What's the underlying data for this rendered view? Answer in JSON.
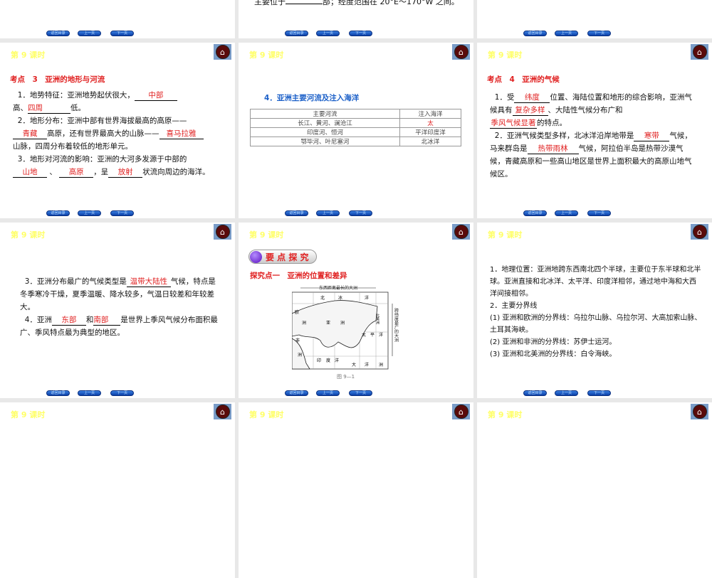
{
  "common": {
    "lesson": "第 9 课时",
    "nav": [
      "返回目录",
      "上一页",
      "下一页"
    ]
  },
  "s_top2": {
    "text": "主要位于",
    "blank": "",
    "rest": "部；经度范围在 20°E～170°W 之间。"
  },
  "s3": {
    "heading": "考点　3　亚洲的地形与河流",
    "p1a": "1．地势特征：亚洲地势起伏很大，",
    "b1": "中部",
    "p1b": "高、",
    "b2": "四周",
    "p1c": "低。",
    "p2a": "2．地形分布：亚洲中部有世界海拔最高的高原——",
    "b3": "青藏",
    "p2b": "高原，还有世界最高大的山脉——",
    "b4": "喜马拉雅",
    "p2c": "山脉，四周分布着较低的地形单元。",
    "p3a": "3．地形对河流的影响：亚洲的大河多发源于中部的",
    "b5": "山地",
    "sep": "、",
    "b6": "高原",
    "p3b": "，呈",
    "b7": "放射",
    "p3c": "状流向周边的海洋。"
  },
  "s4": {
    "heading": "4．亚洲主要河流及注入海洋",
    "headers": [
      "主要河流",
      "注入海洋"
    ],
    "rows": [
      [
        "长江、黄河、澜沧江",
        "太"
      ],
      [
        "印度河、恒河",
        "平洋印度洋"
      ],
      [
        "鄂毕河、叶尼塞河",
        "北冰洋"
      ]
    ]
  },
  "s5": {
    "heading": "考点　4　亚洲的气候",
    "p1a": "1．受",
    "b1": "纬度",
    "p1b": "位置、海陆位置和地形的综合影响，亚洲气候具有",
    "b2": "复杂多样",
    "p1c": "、大陆性气候分布广和",
    "b3": "季风气候显著",
    "p1d": "的特点。",
    "p2a": "2．亚洲气候类型多样，北冰洋沿岸地带是",
    "b4": "寒带",
    "p2b": "气候，马来群岛是",
    "b5": "热带雨林",
    "p2c": "气候，阿拉伯半岛是热带沙漠气候，青藏高原和一些高山地区是世界上面积最大的高原山地气候区。"
  },
  "s6": {
    "p3a": "3．亚洲分布最广的气候类型是",
    "b1": "温带大陆性",
    "p3b": "气候，特点是冬季寒冷干燥，夏季温暖、降水较多，气温日较差和年较差大。",
    "p4a": "4．亚洲",
    "b2": "东部",
    "p4b": "和",
    "b3": "南部",
    "p4c": "是世界上季风气候分布面积最广、季风特点最为典型的地区。"
  },
  "s7": {
    "banner": "要 点 探 究",
    "heading": "探究点一　亚洲的位置和差异",
    "map_top": "东西距离最长的大洲",
    "map_side": "跨纬度最广的大洲",
    "labels": [
      "北",
      "冰",
      "洋",
      "亚",
      "洲",
      "欧",
      "洲",
      "非",
      "洲",
      "印",
      "度",
      "洋",
      "太",
      "平",
      "洋",
      "大",
      "洋",
      "洲",
      "北美洲"
    ],
    "caption": "图 9—1"
  },
  "s8": {
    "lines": [
      "1．地理位置：亚洲地跨东西南北四个半球，主要位于东半球和北半球。亚洲直接和北冰洋、太平洋、印度洋相邻，通过地中海和大西洋间接相邻。",
      "2．主要分界线",
      "(1) 亚洲和欧洲的分界线：乌拉尔山脉、乌拉尔河、大高加索山脉、土耳其海峡。",
      "(2) 亚洲和非洲的分界线：苏伊士运河。",
      "(3) 亚洲和北美洲的分界线：白令海峡。"
    ]
  }
}
